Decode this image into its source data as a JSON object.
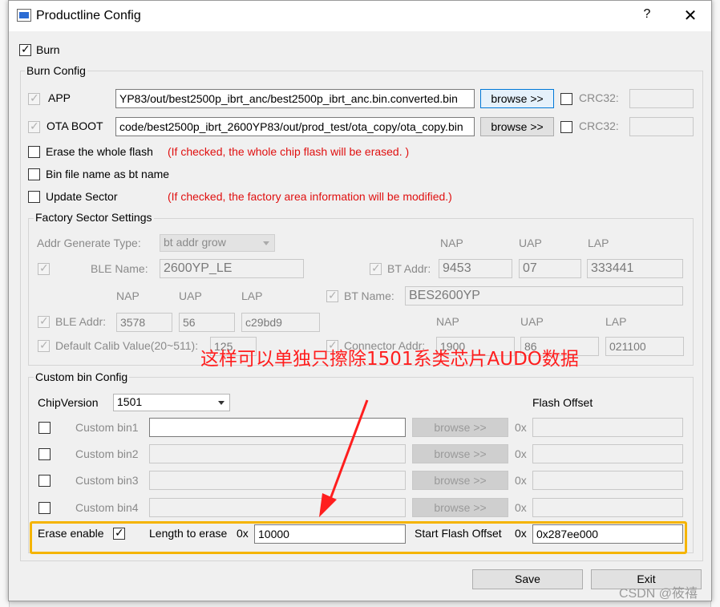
{
  "window": {
    "title": "Productline Config",
    "help": "?",
    "close": "✕"
  },
  "burn": {
    "label": "Burn",
    "checked": true
  },
  "burn_config": {
    "title": "Burn Config",
    "app": {
      "label": "APP",
      "path": "YP83/out/best2500p_ibrt_anc/best2500p_ibrt_anc.bin.converted.bin",
      "browse": "browse >>",
      "crc_label": "CRC32:"
    },
    "ota": {
      "label": "OTA BOOT",
      "path": "code/best2500p_ibrt_2600YP83/out/prod_test/ota_copy/ota_copy.bin",
      "browse": "browse >>",
      "crc_label": "CRC32:"
    },
    "erase_whole": {
      "label": "Erase the whole flash",
      "warning": "(If checked, the whole chip flash will be erased. )"
    },
    "bin_name": {
      "label": "Bin file name as bt name"
    },
    "update_sector": {
      "label": "Update Sector",
      "warning": "(If checked, the factory area information will be modified.)"
    }
  },
  "factory": {
    "title": "Factory Sector Settings",
    "addr_type_label": "Addr Generate Type:",
    "addr_type_value": "bt addr grow",
    "col_nap": "NAP",
    "col_uap": "UAP",
    "col_lap": "LAP",
    "ble_name_label": "BLE Name:",
    "ble_name": "2600YP_LE",
    "bt_addr_label": "BT Addr:",
    "bt_addr": {
      "nap": "9453",
      "uap": "07",
      "lap": "333441"
    },
    "bt_name_label": "BT Name:",
    "bt_name": "BES2600YP",
    "ble_addr_label": "BLE Addr:",
    "ble_addr": {
      "nap": "3578",
      "uap": "56",
      "lap": "c29bd9"
    },
    "calib_label": "Default Calib Value(20~511):",
    "calib_value": "125",
    "connector_label": "Connector Addr:",
    "connector_addr": {
      "nap": "1900",
      "uap": "86",
      "lap": "021100"
    }
  },
  "custom": {
    "title": "Custom bin Config",
    "chip_label": "ChipVersion",
    "chip_value": "1501",
    "flash_offset_label": "Flash Offset",
    "bins": [
      {
        "label": "Custom bin1",
        "browse": "browse >>",
        "prefix": "0x"
      },
      {
        "label": "Custom bin2",
        "browse": "browse >>",
        "prefix": "0x"
      },
      {
        "label": "Custom bin3",
        "browse": "browse >>",
        "prefix": "0x"
      },
      {
        "label": "Custom bin4",
        "browse": "browse >>",
        "prefix": "0x"
      }
    ],
    "erase_enable_label": "Erase enable",
    "erase_enable": true,
    "length_label": "Length to erase",
    "length_prefix": "0x",
    "length_value": "10000",
    "start_label": "Start Flash Offset",
    "start_prefix": "0x",
    "start_value": "0x287ee000"
  },
  "annotation": "这样可以单独只擦除1501系类芯片AUDO数据",
  "buttons": {
    "save": "Save",
    "exit": "Exit"
  },
  "watermark": "CSDN @筱禧",
  "colors": {
    "warning": "#e01010",
    "annotation": "#ff1e1e",
    "highlight": "#f5b400",
    "primary_border": "#0078d7"
  }
}
